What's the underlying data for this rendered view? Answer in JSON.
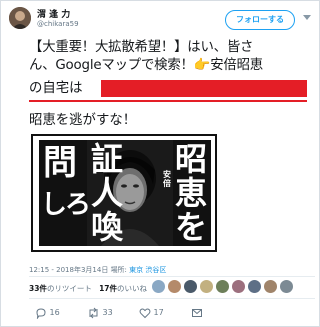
{
  "user": {
    "name": "渭 逢 力",
    "handle": "@chikara59"
  },
  "follow_button": {
    "label": "フォローする"
  },
  "tweet": {
    "line1": "【大重要！大拡散希望！】はい、皆さ",
    "line2": "ん、Googleマップで検索！👉安倍昭恵",
    "line3_prefix": "の自宅は",
    "line4": "昭恵を逃がすな！"
  },
  "poster": {
    "col_left_top": "問",
    "col_left_bottom": "しろ",
    "col_mid": "証人喚",
    "col_right": "昭恵を",
    "col_right_small": "安倍"
  },
  "meta": {
    "time": "12:15 - 2018年3月14日",
    "place_prefix": "場所: ",
    "place": "東京 渋谷区"
  },
  "stats": {
    "retweet_count": "33件",
    "retweet_label": "のリツイート",
    "like_count": "17件",
    "like_label": "のいいね"
  },
  "actions": {
    "reply_count": "16",
    "retweet_count": "33",
    "like_count": "17"
  },
  "colors": {
    "accent": "#1da1f2",
    "redaction": "#e41e26"
  }
}
